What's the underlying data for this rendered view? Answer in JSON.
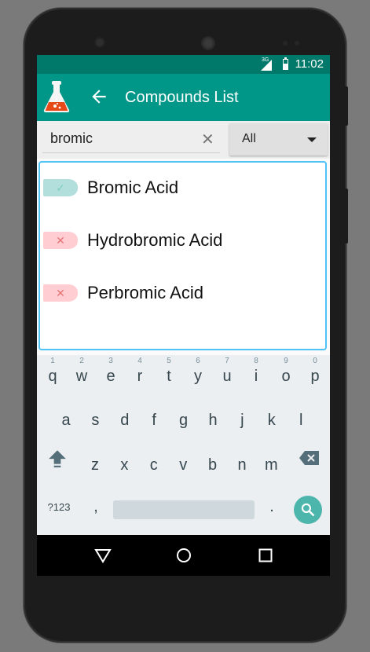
{
  "status_bar": {
    "network": "3G",
    "time": "11:02"
  },
  "app_bar": {
    "title": "Compounds List",
    "logo_icon": "flask-icon",
    "back_icon": "back-arrow-icon"
  },
  "search": {
    "value": "bromic",
    "clear_icon": "clear-icon"
  },
  "filter": {
    "selected": "All"
  },
  "results": [
    {
      "label": "Bromic Acid",
      "status": "check",
      "mark": "✓",
      "badge_color": "#b2dfdb",
      "mark_color": "#80cbc4"
    },
    {
      "label": "Hydrobromic Acid",
      "status": "cross",
      "mark": "✕",
      "badge_color": "#ffcdd2",
      "mark_color": "#e57373"
    },
    {
      "label": "Perbromic Acid",
      "status": "cross",
      "mark": "✕",
      "badge_color": "#ffcdd2",
      "mark_color": "#e57373"
    }
  ],
  "keyboard": {
    "row1": [
      {
        "k": "q",
        "n": "1"
      },
      {
        "k": "w",
        "n": "2"
      },
      {
        "k": "e",
        "n": "3"
      },
      {
        "k": "r",
        "n": "4"
      },
      {
        "k": "t",
        "n": "5"
      },
      {
        "k": "y",
        "n": "6"
      },
      {
        "k": "u",
        "n": "7"
      },
      {
        "k": "i",
        "n": "8"
      },
      {
        "k": "o",
        "n": "9"
      },
      {
        "k": "p",
        "n": "0"
      }
    ],
    "row2": [
      "a",
      "s",
      "d",
      "f",
      "g",
      "h",
      "j",
      "k",
      "l"
    ],
    "row3": [
      "z",
      "x",
      "c",
      "v",
      "b",
      "n",
      "m"
    ],
    "symbols_label": "?123",
    "comma": ",",
    "period": ".",
    "shift_icon": "shift-icon",
    "backspace_icon": "backspace-icon",
    "search_icon": "search-icon"
  },
  "nav_bar": {
    "back_icon": "nav-back-icon",
    "home_icon": "nav-home-icon",
    "recents_icon": "nav-recents-icon"
  },
  "colors": {
    "status_bar": "#00796b",
    "app_bar": "#009688",
    "accent": "#4fc3f7",
    "keyboard_action": "#4db6ac"
  }
}
